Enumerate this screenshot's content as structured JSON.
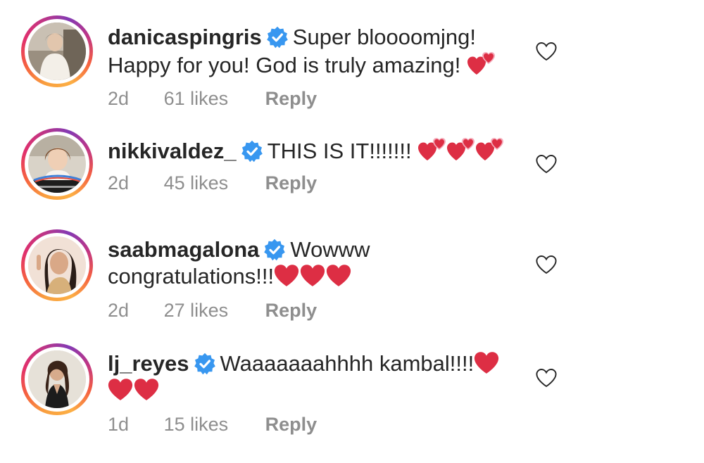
{
  "colors": {
    "verified": "#3897f0",
    "heart_red": "#dd2e44",
    "meta_gray": "#8e8e8e",
    "text": "#262626"
  },
  "comments": [
    {
      "username": "danicaspingris",
      "verified": true,
      "text": "Super bloooomjng! Happy for you! God is truly amazing!",
      "emoji": [
        "two-hearts-icon"
      ],
      "age": "2d",
      "likes": "61 likes",
      "reply": "Reply"
    },
    {
      "username": "nikkivaldez_",
      "verified": true,
      "text": "THIS IS IT!!!!!!!",
      "emoji": [
        "two-hearts-icon",
        "two-hearts-icon",
        "two-hearts-icon"
      ],
      "age": "2d",
      "likes": "45 likes",
      "reply": "Reply"
    },
    {
      "username": "saabmagalona",
      "verified": true,
      "text": "Wowww congratulations!!!",
      "emoji": [
        "red-heart-icon",
        "red-heart-icon",
        "red-heart-icon"
      ],
      "age": "2d",
      "likes": "27 likes",
      "reply": "Reply"
    },
    {
      "username": "lj_reyes",
      "verified": true,
      "text": "Waaaaaaahhhh kambal!!!!",
      "emoji": [
        "red-heart-icon",
        "red-heart-icon",
        "red-heart-icon"
      ],
      "age": "1d",
      "likes": "15 likes",
      "reply": "Reply"
    }
  ]
}
